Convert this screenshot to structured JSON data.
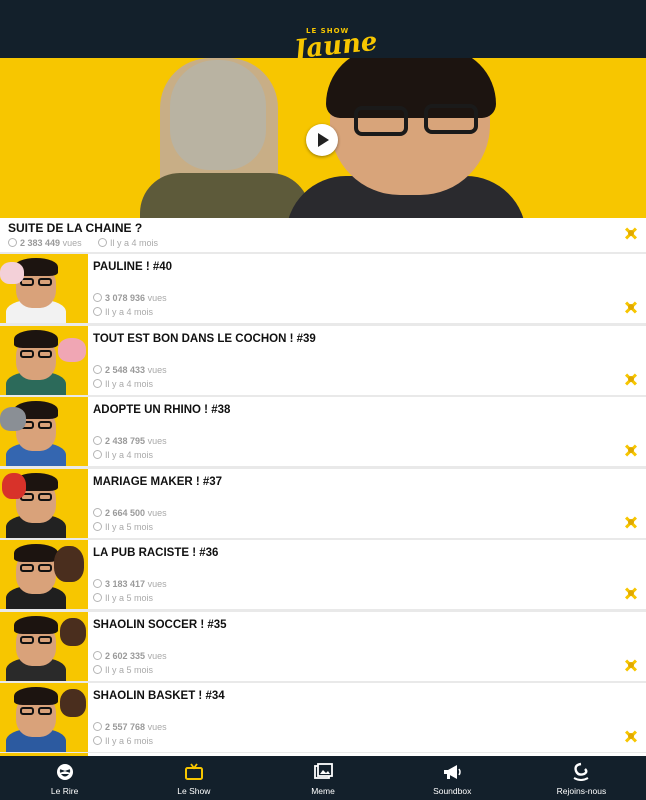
{
  "logo": {
    "small": "LE SHOW",
    "big": "Jaune"
  },
  "colors": {
    "brand_yellow": "#f7c600",
    "navy": "#13202b",
    "meta_gray": "#a9a9a9"
  },
  "featured": {
    "title": "SUITE DE LA CHAINE ?",
    "views": "2 383 449",
    "views_unit": "vues",
    "age": "Il y a 4 mois"
  },
  "videos": [
    {
      "title": "PAULINE !  #40",
      "views": "3 078 936",
      "views_unit": "vues",
      "age": "Il y a 4 mois"
    },
    {
      "title": "TOUT EST BON DANS LE COCHON !  #39",
      "views": "2 548 433",
      "views_unit": "vues",
      "age": "Il y a 4 mois"
    },
    {
      "title": "ADOPTE UN RHINO !  #38",
      "views": "2 438 795",
      "views_unit": "vues",
      "age": "Il y a 4 mois"
    },
    {
      "title": "MARIAGE MAKER !  #37",
      "views": "2 664 500",
      "views_unit": "vues",
      "age": "Il y a 5 mois"
    },
    {
      "title": "LA PUB RACISTE !  #36",
      "views": "3 183 417",
      "views_unit": "vues",
      "age": "Il y a 5 mois"
    },
    {
      "title": "SHAOLIN SOCCER !  #35",
      "views": "2 602 335",
      "views_unit": "vues",
      "age": "Il y a 5 mois"
    },
    {
      "title": "SHAOLIN BASKET !  #34",
      "views": "2 557 768",
      "views_unit": "vues",
      "age": "Il y a 6 mois"
    }
  ],
  "tabs": [
    {
      "label": "Le Rire",
      "icon": "laugh-face-icon",
      "active": false
    },
    {
      "label": "Le Show",
      "icon": "tv-icon",
      "active": true
    },
    {
      "label": "Meme",
      "icon": "photos-icon",
      "active": false
    },
    {
      "label": "Soundbox",
      "icon": "megaphone-icon",
      "active": false
    },
    {
      "label": "Rejoins-nous",
      "icon": "swan-icon",
      "active": false
    }
  ]
}
